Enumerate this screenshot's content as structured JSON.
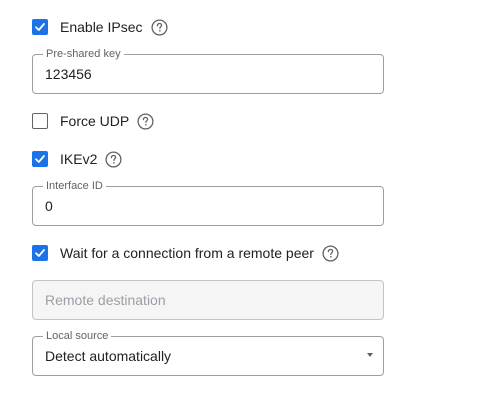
{
  "colors": {
    "accent": "#1a73e8",
    "text": "#202124",
    "muted": "#5f6368",
    "placeholder": "#9aa0a6",
    "border": "#9e9e9e",
    "disabled_bg": "#f5f5f5"
  },
  "enable_ipsec": {
    "label": "Enable IPsec",
    "checked": true,
    "icon": "help-circle-icon"
  },
  "pre_shared_key": {
    "label": "Pre-shared key",
    "value": "123456"
  },
  "force_udp": {
    "label": "Force UDP",
    "checked": false,
    "icon": "help-circle-icon"
  },
  "ikev2": {
    "label": "IKEv2",
    "checked": true,
    "icon": "help-circle-icon"
  },
  "interface_id": {
    "label": "Interface ID",
    "value": "0"
  },
  "wait_for_peer": {
    "label": "Wait for a connection from a remote peer",
    "checked": true,
    "icon": "help-circle-icon"
  },
  "remote_destination": {
    "placeholder": "Remote destination",
    "disabled": true
  },
  "local_source": {
    "label": "Local source",
    "selected": "Detect automatically",
    "icon": "dropdown-arrow-icon"
  }
}
